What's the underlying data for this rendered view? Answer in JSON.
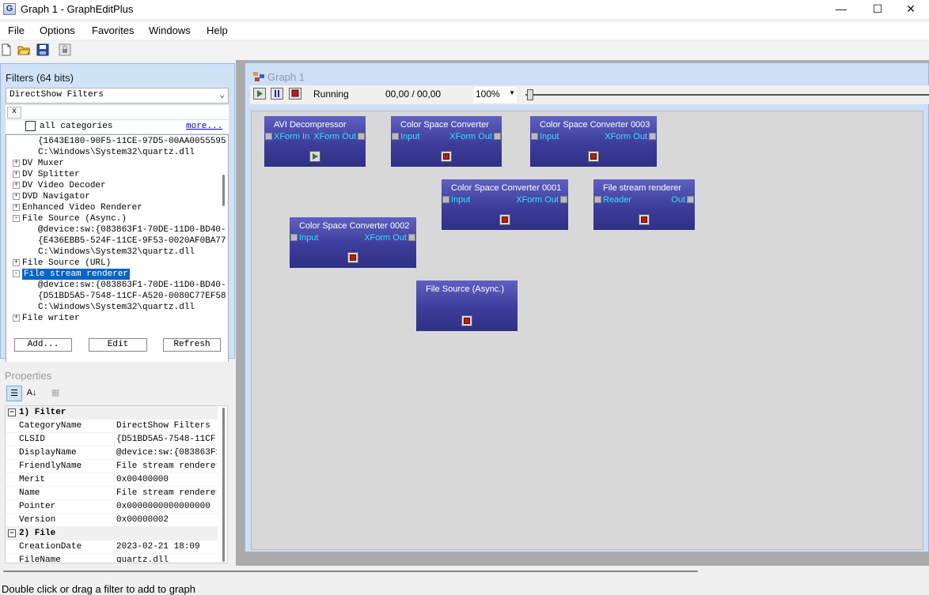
{
  "window": {
    "title": "Graph 1 - GraphEditPlus",
    "icon_letter": "G",
    "controls": {
      "minimize": "—",
      "maximize": "☐",
      "close": "✕"
    }
  },
  "menu": [
    "File",
    "Options",
    "Favorites",
    "Windows",
    "Help"
  ],
  "toolbar_icons": [
    "new-file-icon",
    "open-folder-icon",
    "save-icon",
    "lock-icon"
  ],
  "filters_panel": {
    "header": "Filters (64 bits)",
    "category": "DirectShow Filters",
    "clear_label": "x",
    "all_categories_label": "all categories",
    "more_link": "more...",
    "tree": [
      {
        "text": "{1643E180-90F5-11CE-97D5-00AA0055595",
        "level": 2,
        "expander": ""
      },
      {
        "text": "C:\\Windows\\System32\\quartz.dll",
        "level": 2,
        "expander": ""
      },
      {
        "text": "DV Muxer",
        "level": 1,
        "expander": "+"
      },
      {
        "text": "DV Splitter",
        "level": 1,
        "expander": "+"
      },
      {
        "text": "DV Video Decoder",
        "level": 1,
        "expander": "+"
      },
      {
        "text": "DVD Navigator",
        "level": 1,
        "expander": "+"
      },
      {
        "text": "Enhanced Video Renderer",
        "level": 1,
        "expander": "+"
      },
      {
        "text": "File Source (Async.)",
        "level": 1,
        "expander": "-"
      },
      {
        "text": "@device:sw:{083863F1-70DE-11D0-BD40-",
        "level": 2,
        "expander": ""
      },
      {
        "text": "{E436EBB5-524F-11CE-9F53-0020AF0BA77",
        "level": 2,
        "expander": ""
      },
      {
        "text": "C:\\Windows\\System32\\quartz.dll",
        "level": 2,
        "expander": ""
      },
      {
        "text": "File Source (URL)",
        "level": 1,
        "expander": "+"
      },
      {
        "text": "File stream renderer",
        "level": 1,
        "expander": "-",
        "selected": true
      },
      {
        "text": "@device:sw:{083863F1-70DE-11D0-BD40-",
        "level": 2,
        "expander": ""
      },
      {
        "text": "{D51BD5A5-7548-11CF-A520-0080C77EF58",
        "level": 2,
        "expander": ""
      },
      {
        "text": "C:\\Windows\\System32\\quartz.dll",
        "level": 2,
        "expander": ""
      },
      {
        "text": "File writer",
        "level": 1,
        "expander": "+"
      }
    ],
    "buttons": {
      "add": "Add...",
      "edit": "Edit",
      "refresh": "Refresh"
    }
  },
  "properties_panel": {
    "header": "Properties",
    "sections": [
      {
        "title": "1) Filter",
        "rows": [
          {
            "name": "CategoryName",
            "value": "DirectShow Filters"
          },
          {
            "name": "CLSID",
            "value": "{D51BD5A5-7548-11CF-A5"
          },
          {
            "name": "DisplayName",
            "value": "@device:sw:{083863F1-7"
          },
          {
            "name": "FriendlyName",
            "value": "File stream renderer"
          },
          {
            "name": "Merit",
            "value": "0x00400000"
          },
          {
            "name": "Name",
            "value": "File stream renderer"
          },
          {
            "name": "Pointer",
            "value": "0x0000000000000000"
          },
          {
            "name": "Version",
            "value": "0x00000002"
          }
        ]
      },
      {
        "title": "2) File",
        "rows": [
          {
            "name": "CreationDate",
            "value": "2023-02-21 18:09"
          },
          {
            "name": "FileName",
            "value": "quartz.dll"
          }
        ]
      }
    ]
  },
  "graph": {
    "title": "Graph 1",
    "state": "Running",
    "time": "00,00 / 00,00",
    "zoom": "100%",
    "filters": [
      {
        "name": "AVI Decompressor",
        "pins": [
          {
            "label": "XForm In",
            "side": "left"
          },
          {
            "label": "XForm Out",
            "side": "right"
          }
        ],
        "button": "play"
      },
      {
        "name": "Color Space Converter",
        "pins": [
          {
            "label": "Input",
            "side": "left"
          },
          {
            "label": "XForm Out",
            "side": "right"
          }
        ],
        "button": "stop"
      },
      {
        "name": "Color Space Converter 0003",
        "pins": [
          {
            "label": "Input",
            "side": "left"
          },
          {
            "label": "XForm Out",
            "side": "right"
          }
        ],
        "button": "stop"
      },
      {
        "name": "Color Space Converter 0001",
        "pins": [
          {
            "label": "Input",
            "side": "left"
          },
          {
            "label": "XForm Out",
            "side": "right"
          }
        ],
        "button": "stop"
      },
      {
        "name": "File stream renderer",
        "pins": [
          {
            "label": "Reader",
            "side": "left"
          },
          {
            "label": "Out",
            "side": "right"
          }
        ],
        "button": "stop"
      },
      {
        "name": "Color Space Converter 0002",
        "pins": [
          {
            "label": "Input",
            "side": "left"
          },
          {
            "label": "XForm Out",
            "side": "right"
          }
        ],
        "button": "stop"
      },
      {
        "name": "File Source (Async.)",
        "pins": [],
        "button": "stop"
      }
    ]
  },
  "status": "Double click or drag a filter to add to graph"
}
